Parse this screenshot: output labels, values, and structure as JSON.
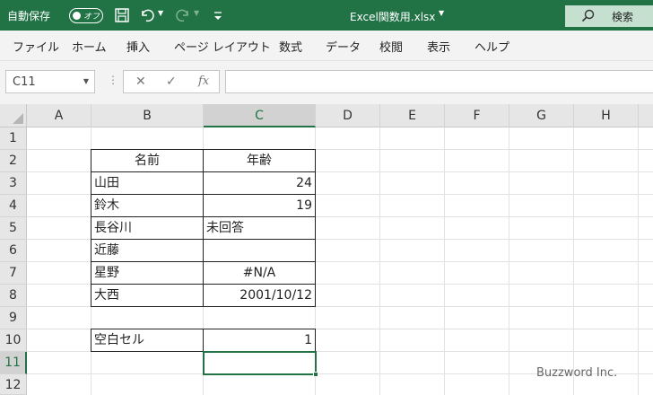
{
  "titlebar": {
    "autosave_label": "自動保存",
    "autosave_state": "オフ",
    "filename": "Excel関数用.xlsx",
    "search_label": "検索"
  },
  "menu": [
    "ファイル",
    "ホーム",
    "挿入",
    "ページ レイアウト",
    "数式",
    "データ",
    "校閲",
    "表示",
    "ヘルプ"
  ],
  "formula_bar": {
    "name_box": "C11",
    "formula": ""
  },
  "sheet": {
    "columns": [
      "A",
      "B",
      "C",
      "D",
      "E",
      "F",
      "G",
      "H"
    ],
    "rows": [
      "1",
      "2",
      "3",
      "4",
      "5",
      "6",
      "7",
      "8",
      "9",
      "10",
      "11",
      "12"
    ],
    "selected_column": "C",
    "selected_row": "11",
    "table": {
      "header": {
        "name": "名前",
        "age": "年齢"
      },
      "rows": [
        {
          "name": "山田",
          "age": "24"
        },
        {
          "name": "鈴木",
          "age": "19"
        },
        {
          "name": "長谷川",
          "age": "未回答"
        },
        {
          "name": "近藤",
          "age": ""
        },
        {
          "name": "星野",
          "age": "#N/A"
        },
        {
          "name": "大西",
          "age": "2001/10/12"
        }
      ]
    },
    "result": {
      "label": "空白セル",
      "value": "1"
    }
  },
  "watermark": "Buzzword Inc.",
  "colors": {
    "accent": "#217346"
  }
}
